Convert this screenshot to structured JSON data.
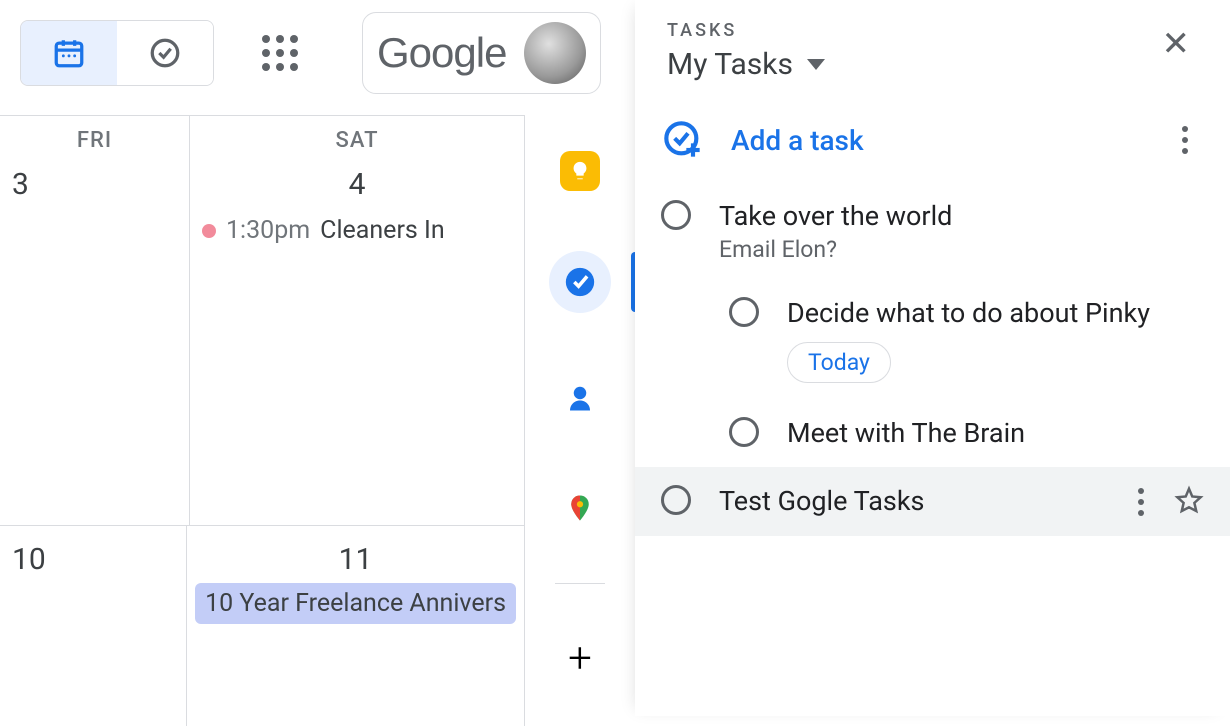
{
  "brand": "Google",
  "calendar": {
    "days": [
      {
        "label": "FRI",
        "num": "3"
      },
      {
        "label": "SAT",
        "num": "4"
      }
    ],
    "event": {
      "time": "1:30pm",
      "title": "Cleaners In"
    },
    "week2": {
      "fri": "10",
      "sat": "11"
    },
    "chip": "10 Year Freelance Annivers"
  },
  "tasks": {
    "header_label": "TASKS",
    "list_name": "My Tasks",
    "add_label": "Add a task",
    "items": [
      {
        "title": "Take over the world",
        "desc": "Email Elon?"
      },
      {
        "title": "Decide what to do about Pinky",
        "chip": "Today"
      },
      {
        "title": "Meet with The Brain"
      },
      {
        "title": "Test Gogle Tasks"
      }
    ]
  }
}
